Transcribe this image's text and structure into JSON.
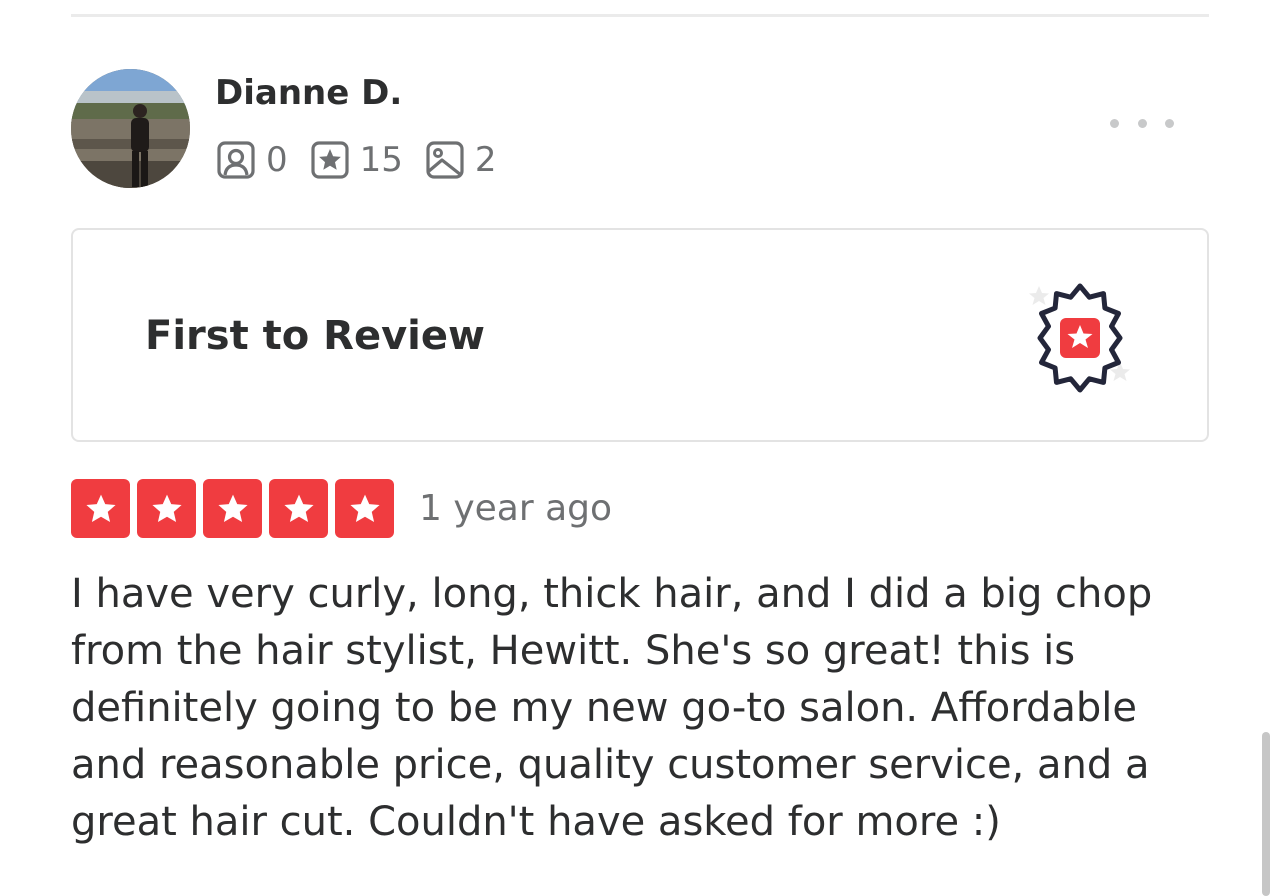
{
  "review": {
    "user": {
      "name": "Dianne D.",
      "avatar_icon": "user-avatar-photo",
      "stats": [
        {
          "icon": "friends-icon",
          "value": "0"
        },
        {
          "icon": "reviews-star-icon",
          "value": "15"
        },
        {
          "icon": "photos-icon",
          "value": "2"
        }
      ]
    },
    "menu_icon": "more-options-icon",
    "badge": {
      "title": "First to Review",
      "icon": "first-to-review-badge-icon"
    },
    "rating": {
      "stars": 5,
      "max": 5,
      "color": "#f03c40"
    },
    "date": "1 year ago",
    "text": "I have very curly, long, thick hair, and I did a big chop from the hair stylist, Hewitt. She's so great! this is definitely going to be my new go-to salon. Affordable and reasonable price, quality customer service, and a great hair cut. Couldn't have asked for more :)"
  }
}
